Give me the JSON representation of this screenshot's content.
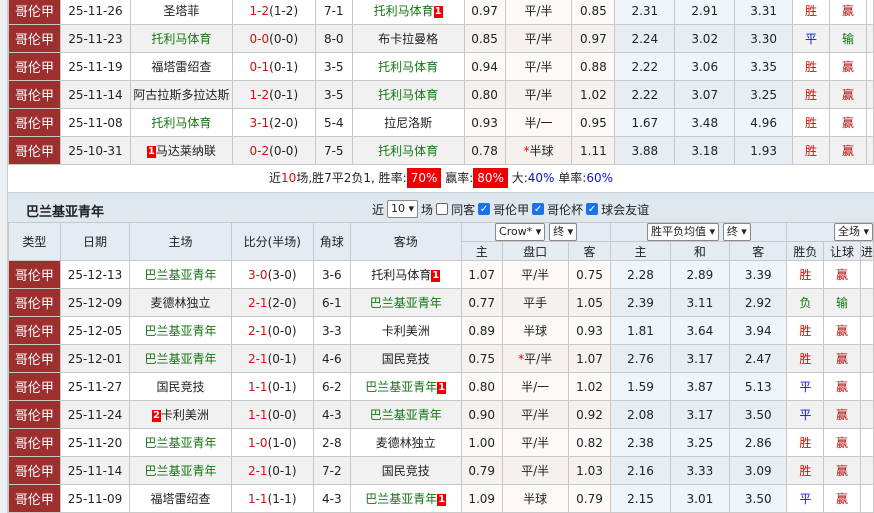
{
  "colors": {
    "type_bg": "#9d2f2f",
    "green": "#117711",
    "red": "#d01010",
    "blue": "#1111cc",
    "badge": "#ee0000"
  },
  "top_rows": [
    {
      "type": "哥伦甲",
      "date": "25-11-26",
      "home": "圣塔菲",
      "home_green": false,
      "home_badge": "",
      "score": "1-2",
      "half": "(1-2)",
      "corner": "7-1",
      "away": "托利马体育",
      "away_green": true,
      "away_badge": "1",
      "oh": "0.97",
      "pk": "平/半",
      "pk_star": "",
      "oa": "0.85",
      "w": "2.31",
      "d": "2.91",
      "l": "3.31",
      "res": "胜",
      "rang": "赢"
    },
    {
      "type": "哥伦甲",
      "date": "25-11-23",
      "home": "托利马体育",
      "home_green": true,
      "home_badge": "",
      "score": "0-0",
      "half": "(0-0)",
      "corner": "8-0",
      "away": "布卡拉曼格",
      "away_green": false,
      "away_badge": "",
      "oh": "0.85",
      "pk": "平/半",
      "pk_star": "",
      "oa": "0.97",
      "w": "2.24",
      "d": "3.02",
      "l": "3.30",
      "res": "平",
      "rang": "输"
    },
    {
      "type": "哥伦甲",
      "date": "25-11-19",
      "home": "福塔雷绍查",
      "home_green": false,
      "home_badge": "",
      "score": "0-1",
      "half": "(0-1)",
      "corner": "3-5",
      "away": "托利马体育",
      "away_green": true,
      "away_badge": "",
      "oh": "0.94",
      "pk": "平/半",
      "pk_star": "",
      "oa": "0.88",
      "w": "2.22",
      "d": "3.06",
      "l": "3.35",
      "res": "胜",
      "rang": "赢"
    },
    {
      "type": "哥伦甲",
      "date": "25-11-14",
      "home": "阿古拉斯多拉达斯",
      "home_green": false,
      "home_badge": "",
      "score": "1-2",
      "half": "(0-1)",
      "corner": "3-5",
      "away": "托利马体育",
      "away_green": true,
      "away_badge": "",
      "oh": "0.80",
      "pk": "平/半",
      "pk_star": "",
      "oa": "1.02",
      "w": "2.22",
      "d": "3.07",
      "l": "3.25",
      "res": "胜",
      "rang": "赢"
    },
    {
      "type": "哥伦甲",
      "date": "25-11-08",
      "home": "托利马体育",
      "home_green": true,
      "home_badge": "",
      "score": "3-1",
      "half": "(2-0)",
      "corner": "5-4",
      "away": "拉尼洛斯",
      "away_green": false,
      "away_badge": "",
      "oh": "0.93",
      "pk": "半/一",
      "pk_star": "",
      "oa": "0.95",
      "w": "1.67",
      "d": "3.48",
      "l": "4.96",
      "res": "胜",
      "rang": "赢"
    },
    {
      "type": "哥伦甲",
      "date": "25-10-31",
      "home": "马达莱纳联",
      "home_green": false,
      "home_badge": "1",
      "score": "0-2",
      "half": "(0-0)",
      "corner": "7-5",
      "away": "托利马体育",
      "away_green": true,
      "away_badge": "",
      "oh": "0.78",
      "pk": "半球",
      "pk_star": "*",
      "oa": "1.11",
      "w": "3.88",
      "d": "3.18",
      "l": "1.93",
      "res": "胜",
      "rang": "赢"
    }
  ],
  "summary": {
    "p1": "近",
    "n": "10",
    "p2": "场,胜7平2负1, 胜率:",
    "win_rate": "70%",
    "p3": " 赢率:",
    "ying_rate": "80%",
    "p4": " 大:",
    "big": "40%",
    "p5": " 单率:",
    "odd": "60%"
  },
  "section": {
    "title": "巴兰基亚青年",
    "near": "近",
    "count": "10",
    "chang": "场",
    "same": "同客",
    "f1": "哥伦甲",
    "f2": "哥伦杯",
    "f3": "球会友谊",
    "same_checked": false,
    "f1_checked": true,
    "f2_checked": true,
    "f3_checked": true
  },
  "headers": {
    "type": "类型",
    "date": "日期",
    "home": "主场",
    "score": "比分(半场)",
    "corner": "角球",
    "away": "客场",
    "company": "Crow*",
    "final1": "终",
    "avg": "胜平负均值",
    "final2": "终",
    "scope": "全场",
    "oh": "主",
    "pk": "盘口",
    "oa": "客",
    "w": "主",
    "d": "和",
    "l": "客",
    "res": "胜负",
    "rang": "让球",
    "next": "进"
  },
  "bottom_rows": [
    {
      "type": "哥伦甲",
      "date": "25-12-13",
      "home": "巴兰基亚青年",
      "home_green": true,
      "home_badge": "",
      "score": "3-0",
      "half": "(3-0)",
      "corner": "3-6",
      "away": "托利马体育",
      "away_green": false,
      "away_badge": "1",
      "oh": "1.07",
      "pk": "平/半",
      "pk_star": "",
      "oa": "0.75",
      "w": "2.28",
      "d": "2.89",
      "l": "3.39",
      "res": "胜",
      "rang": "赢"
    },
    {
      "type": "哥伦甲",
      "date": "25-12-09",
      "home": "麦德林独立",
      "home_green": false,
      "home_badge": "",
      "score": "2-1",
      "half": "(2-0)",
      "corner": "6-1",
      "away": "巴兰基亚青年",
      "away_green": true,
      "away_badge": "",
      "oh": "0.77",
      "pk": "平手",
      "pk_star": "",
      "oa": "1.05",
      "w": "2.39",
      "d": "3.11",
      "l": "2.92",
      "res": "负",
      "rang": "输"
    },
    {
      "type": "哥伦甲",
      "date": "25-12-05",
      "home": "巴兰基亚青年",
      "home_green": true,
      "home_badge": "",
      "score": "2-1",
      "half": "(0-0)",
      "corner": "3-3",
      "away": "卡利美洲",
      "away_green": false,
      "away_badge": "",
      "oh": "0.89",
      "pk": "半球",
      "pk_star": "",
      "oa": "0.93",
      "w": "1.81",
      "d": "3.64",
      "l": "3.94",
      "res": "胜",
      "rang": "赢"
    },
    {
      "type": "哥伦甲",
      "date": "25-12-01",
      "home": "巴兰基亚青年",
      "home_green": true,
      "home_badge": "",
      "score": "2-1",
      "half": "(0-1)",
      "corner": "4-6",
      "away": "国民竞技",
      "away_green": false,
      "away_badge": "",
      "oh": "0.75",
      "pk": "平/半",
      "pk_star": "*",
      "oa": "1.07",
      "w": "2.76",
      "d": "3.17",
      "l": "2.47",
      "res": "胜",
      "rang": "赢"
    },
    {
      "type": "哥伦甲",
      "date": "25-11-27",
      "home": "国民竞技",
      "home_green": false,
      "home_badge": "",
      "score": "1-1",
      "half": "(0-1)",
      "corner": "6-2",
      "away": "巴兰基亚青年",
      "away_green": true,
      "away_badge": "1",
      "oh": "0.80",
      "pk": "半/一",
      "pk_star": "",
      "oa": "1.02",
      "w": "1.59",
      "d": "3.87",
      "l": "5.13",
      "res": "平",
      "rang": "赢"
    },
    {
      "type": "哥伦甲",
      "date": "25-11-24",
      "home": "卡利美洲",
      "home_green": false,
      "home_badge": "2",
      "score": "1-1",
      "half": "(0-0)",
      "corner": "4-3",
      "away": "巴兰基亚青年",
      "away_green": true,
      "away_badge": "",
      "oh": "0.90",
      "pk": "平/半",
      "pk_star": "",
      "oa": "0.92",
      "w": "2.08",
      "d": "3.17",
      "l": "3.50",
      "res": "平",
      "rang": "赢"
    },
    {
      "type": "哥伦甲",
      "date": "25-11-20",
      "home": "巴兰基亚青年",
      "home_green": true,
      "home_badge": "",
      "score": "1-0",
      "half": "(1-0)",
      "corner": "2-8",
      "away": "麦德林独立",
      "away_green": false,
      "away_badge": "",
      "oh": "1.00",
      "pk": "平/半",
      "pk_star": "",
      "oa": "0.82",
      "w": "2.38",
      "d": "3.25",
      "l": "2.86",
      "res": "胜",
      "rang": "赢"
    },
    {
      "type": "哥伦甲",
      "date": "25-11-14",
      "home": "巴兰基亚青年",
      "home_green": true,
      "home_badge": "",
      "score": "2-1",
      "half": "(0-1)",
      "corner": "7-2",
      "away": "国民竞技",
      "away_green": false,
      "away_badge": "",
      "oh": "0.79",
      "pk": "平/半",
      "pk_star": "",
      "oa": "1.03",
      "w": "2.16",
      "d": "3.33",
      "l": "3.09",
      "res": "胜",
      "rang": "赢"
    },
    {
      "type": "哥伦甲",
      "date": "25-11-09",
      "home": "福塔雷绍查",
      "home_green": false,
      "home_badge": "",
      "score": "1-1",
      "half": "(1-1)",
      "corner": "4-3",
      "away": "巴兰基亚青年",
      "away_green": true,
      "away_badge": "1",
      "oh": "1.09",
      "pk": "半球",
      "pk_star": "",
      "oa": "0.79",
      "w": "2.15",
      "d": "3.01",
      "l": "3.50",
      "res": "平",
      "rang": "赢"
    }
  ]
}
